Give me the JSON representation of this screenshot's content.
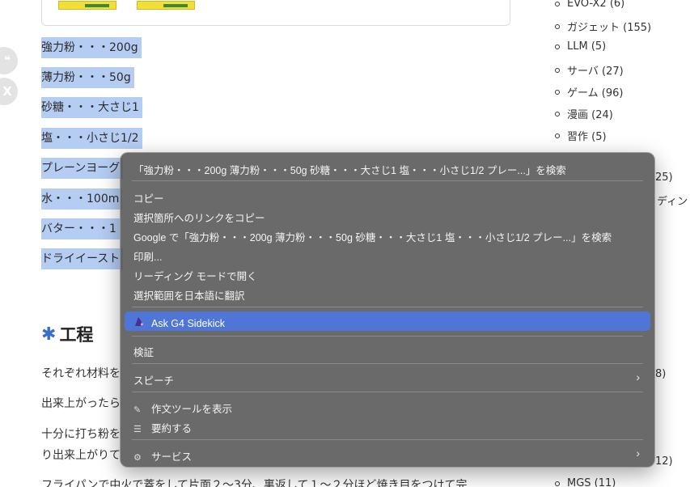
{
  "share": {
    "quote_icon": "❝",
    "x_icon": "X"
  },
  "ingredients": [
    "強力粉・・・200g",
    "薄力粉・・・50g",
    "砂糖・・・大さじ1",
    "塩・・・小さじ1/2",
    "プレーンヨーグ",
    "水・・・100m",
    "バター・・・1",
    "ドライイースト"
  ],
  "heading": {
    "icon": "✱",
    "title": "工程"
  },
  "paragraphs": [
    "それぞれ材料を",
    "出来上がったら",
    "十分に打ち粉を",
    "り出来上がりて",
    "フライパンで中火で蓋をして片面２〜3分、裏返して１〜２分ほど焼き目をつけて完"
  ],
  "sidebar": {
    "categories": [
      "EVO-X2 (6)",
      "ガジェット (155)",
      "LLM (5)",
      "サーバ (27)",
      "ゲーム (96)",
      "漫画 (24)",
      "習作 (5)",
      "MGS (11)"
    ],
    "partial": [
      "25)",
      "ディン",
      "8)",
      "12)"
    ]
  },
  "context_menu": {
    "search_item": "「強力粉・・・200g  薄力粉・・・50g  砂糖・・・大さじ1  塩・・・小さじ1/2  プレー...」を検索",
    "copy": "コピー",
    "copy_link": "選択箇所へのリンクをコピー",
    "google_search": "Google で「強力粉・・・200g  薄力粉・・・50g  砂糖・・・大さじ1  塩・・・小さじ1/2  プレー...」を検索",
    "print": "印刷...",
    "reading_mode": "リーディング モードで開く",
    "translate": "選択範囲を日本語に翻訳",
    "ask_sidekick": "Ask G4 Sidekick",
    "inspect": "検証",
    "speech": "スピーチ",
    "writing_tools": "作文ツールを表示",
    "summarize": "要約する",
    "services": "サービス"
  }
}
